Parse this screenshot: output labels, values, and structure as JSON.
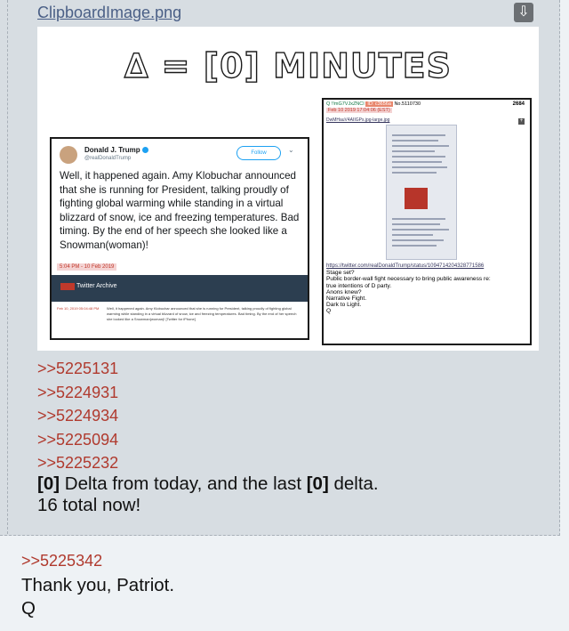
{
  "post": {
    "filename": "ClipboardImage.png",
    "download_icon": "download-icon",
    "image": {
      "headline": "∆ = [0] MINUTES",
      "tweet": {
        "name": "Donald J. Trump",
        "handle": "@realDonaldTrump",
        "follow_label": "Follow",
        "text": "Well, it happened again. Amy Klobuchar announced that she is running for President, talking proudly of fighting global warming while standing in a virtual blizzard of snow, ice and freezing temperatures. Bad timing. By the end of her speech she looked like a Snowman(woman)!",
        "time": "5:04 PM - 10 Feb 2019",
        "archive_label": "Twitter Archive",
        "archive_date": "Feb 10, 2019 05:04:48 PM",
        "archive_text": "Well, it happened again. Amy Klobuchar announced that she is running for President, talking proudly of fighting global warming while standing in a virtual blizzard of snow, ice and freezing temperatures. Bad timing. By the end of her speech she looked like a Snowman(woman)! [Twitter for iPhone]"
      },
      "qpost": {
        "trip": "Q !!mG7VJxZNCI",
        "id": "ID: c3656a",
        "no": "No.5110730",
        "count": "2684",
        "date": "Feb 10 2019 17:04:06 (EST)",
        "file_link": "DwMHauV4AIIGPs.jpg-large.jpg",
        "url": "https://twitter.com/realDonaldTrump/status/1094714204328771586",
        "lines": [
          "Stage set?",
          "Public border-wall fight necessary to bring public awareness re:",
          "true intentions of D party.",
          "Anons knew?",
          "Narrative Fight.",
          "Dark to Light.",
          "Q"
        ]
      }
    },
    "reply_links": [
      ">>5225131",
      ">>5224931",
      ">>5224934",
      ">>5225094",
      ">>5225232"
    ],
    "message_line1_bold1": "[0]",
    "message_line1_mid": " Delta from today, and the last ",
    "message_line1_bold2": "[0]",
    "message_line1_end": " delta.",
    "message_line2": "16 total now!"
  },
  "post2": {
    "reply_link": ">>5225342",
    "lines": [
      "Thank you, Patriot.",
      "Q"
    ]
  }
}
